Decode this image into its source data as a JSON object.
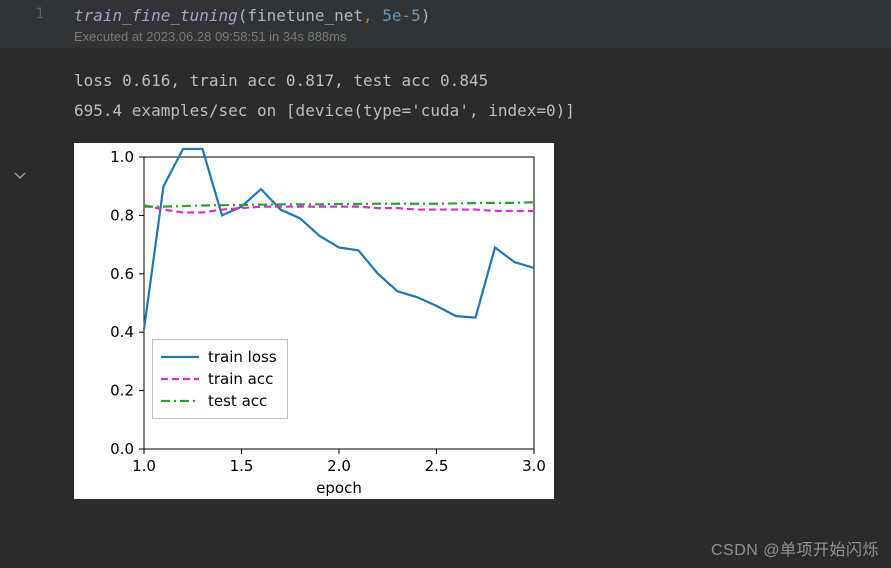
{
  "cell": {
    "line_number": "1",
    "code_tokens": {
      "fn": "train_fine_tuning",
      "open": "(",
      "arg1": "finetune_net",
      "comma": ",",
      "space": " ",
      "arg2": "5e-5",
      "close": ")"
    },
    "exec_meta": "Executed at 2023.06.28 09:58:51 in 34s 888ms"
  },
  "output": {
    "line1": "loss 0.616, train acc 0.817, test acc 0.845",
    "line2": "695.4 examples/sec on [device(type='cuda', index=0)]"
  },
  "legend": {
    "train_loss": "train loss",
    "train_acc": "train acc",
    "test_acc": "test acc"
  },
  "watermark": "CSDN @单项开始闪烁",
  "chart_data": {
    "type": "line",
    "xlabel": "epoch",
    "ylabel": "",
    "title": "",
    "xlim": [
      1.0,
      3.0
    ],
    "ylim": [
      0.0,
      1.0
    ],
    "xticks": [
      "1.0",
      "1.5",
      "2.0",
      "2.5",
      "3.0"
    ],
    "yticks": [
      "0.0",
      "0.2",
      "0.4",
      "0.6",
      "0.8",
      "1.0"
    ],
    "x": [
      1.0,
      1.1,
      1.2,
      1.3,
      1.4,
      1.5,
      1.6,
      1.7,
      1.8,
      1.9,
      2.0,
      2.1,
      2.2,
      2.3,
      2.4,
      2.5,
      2.6,
      2.7,
      2.8,
      2.9,
      3.0
    ],
    "series": [
      {
        "name": "train loss",
        "color": "#1f77b4",
        "style": "solid",
        "values": [
          0.41,
          0.9,
          1.15,
          1.02,
          0.8,
          0.83,
          0.89,
          0.82,
          0.79,
          0.73,
          0.69,
          0.68,
          0.6,
          0.54,
          0.52,
          0.49,
          0.455,
          0.45,
          0.69,
          0.64,
          0.62
        ]
      },
      {
        "name": "train acc",
        "color": "#d62fd6",
        "style": "dashed",
        "values": [
          0.835,
          0.82,
          0.81,
          0.81,
          0.82,
          0.825,
          0.83,
          0.83,
          0.83,
          0.83,
          0.83,
          0.83,
          0.825,
          0.825,
          0.82,
          0.82,
          0.82,
          0.82,
          0.815,
          0.815,
          0.815
        ]
      },
      {
        "name": "test acc",
        "color": "#2ca02c",
        "style": "dashdot",
        "values": [
          0.83,
          0.83,
          0.832,
          0.834,
          0.835,
          0.836,
          0.837,
          0.838,
          0.838,
          0.838,
          0.839,
          0.839,
          0.84,
          0.84,
          0.84,
          0.84,
          0.841,
          0.842,
          0.843,
          0.843,
          0.845
        ]
      }
    ]
  }
}
